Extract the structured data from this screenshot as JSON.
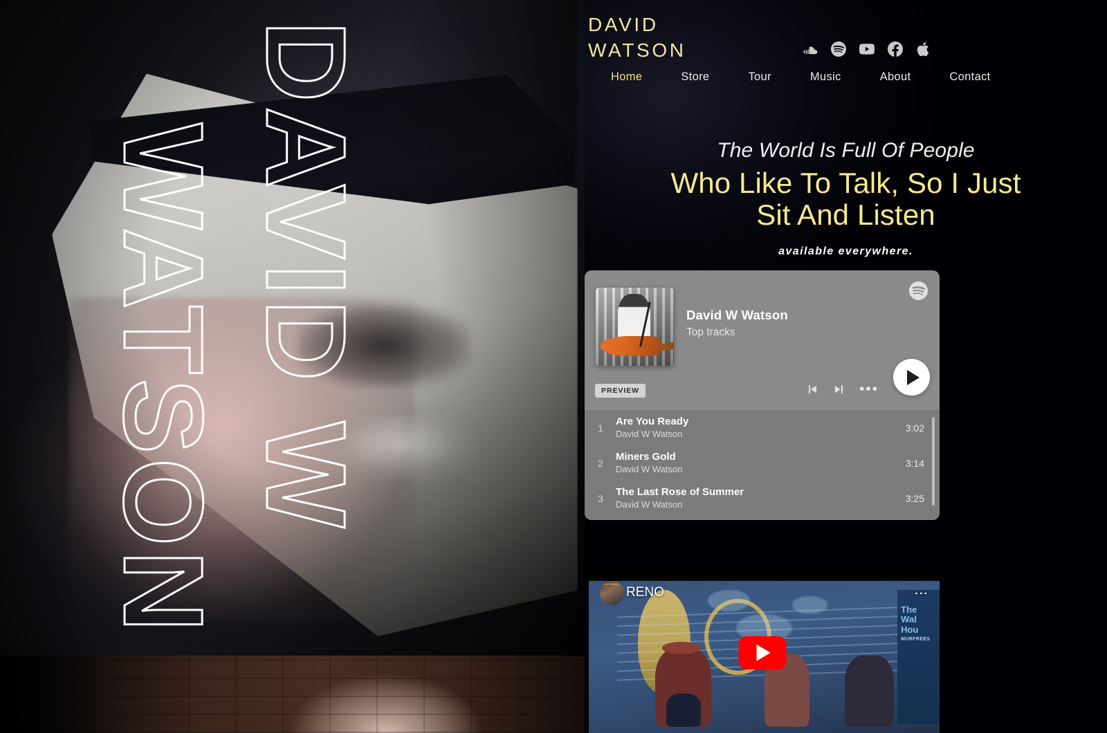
{
  "brand": {
    "line1": "DAVID",
    "line2": "WATSON",
    "accent_color": "#f5e79e"
  },
  "hero": {
    "wordmark_line1": "DAVID W",
    "wordmark_line2": "WATSON"
  },
  "socials": [
    {
      "name": "soundcloud-icon",
      "label": "SoundCloud"
    },
    {
      "name": "spotify-icon",
      "label": "Spotify"
    },
    {
      "name": "youtube-icon",
      "label": "YouTube"
    },
    {
      "name": "facebook-icon",
      "label": "Facebook"
    },
    {
      "name": "apple-music-icon",
      "label": "Apple Music"
    }
  ],
  "nav": {
    "items": [
      {
        "label": "Home",
        "active": true
      },
      {
        "label": "Store",
        "active": false
      },
      {
        "label": "Tour",
        "active": false
      },
      {
        "label": "Music",
        "active": false
      },
      {
        "label": "About",
        "active": false
      },
      {
        "label": "Contact",
        "active": false
      }
    ]
  },
  "headline": {
    "subtitle": "The World Is Full Of People",
    "title_line1": "Who Like To Talk, So I Just",
    "title_line2": "Sit And Listen",
    "availability": "available everywhere.",
    "accent_color": "#f6e98f"
  },
  "spotify": {
    "artist": "David W Watson",
    "subtitle": "Top tracks",
    "preview_badge": "PREVIEW",
    "logo_icon": "spotify-icon",
    "controls": {
      "previous": "skip-previous-icon",
      "next": "skip-next-icon",
      "more": "more-options-icon",
      "play": "play-icon"
    },
    "tracks": [
      {
        "index": "1",
        "title": "Are You Ready",
        "artist": "David W Watson",
        "duration": "3:02"
      },
      {
        "index": "2",
        "title": "Miners Gold",
        "artist": "David W Watson",
        "duration": "3:14"
      },
      {
        "index": "3",
        "title": "The Last Rose of Summer",
        "artist": "David W Watson",
        "duration": "3:25"
      }
    ]
  },
  "youtube": {
    "title": "RENO",
    "menu_icon": "more-vertical-icon",
    "play_icon": "youtube-play-icon",
    "stage_banner_line1": "The",
    "stage_banner_line2": "Wal",
    "stage_banner_line3": "Hou",
    "stage_banner_sub": "MURFREES"
  }
}
